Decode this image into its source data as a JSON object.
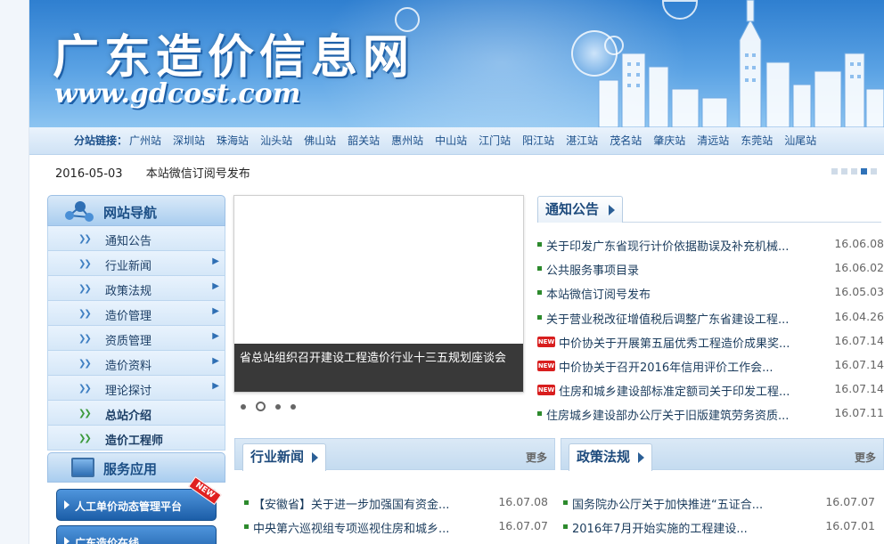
{
  "banner": {
    "title": "广东造价信息网",
    "url": "www.gdcost.com"
  },
  "branch": {
    "label": "分站链接：",
    "items": [
      "广州站",
      "深圳站",
      "珠海站",
      "汕头站",
      "佛山站",
      "韶关站",
      "惠州站",
      "中山站",
      "江门站",
      "阳江站",
      "湛江站",
      "茂名站",
      "肇庆站",
      "清远站",
      "东莞站",
      "汕尾站"
    ]
  },
  "ticker": {
    "date": "2016-05-03",
    "text": "本站微信订阅号发布"
  },
  "nav": {
    "title": "网站导航",
    "items": [
      {
        "label": "通知公告",
        "bold": false,
        "chevron": false
      },
      {
        "label": "行业新闻",
        "bold": false,
        "chevron": true
      },
      {
        "label": "政策法规",
        "bold": false,
        "chevron": true
      },
      {
        "label": "造价管理",
        "bold": false,
        "chevron": true
      },
      {
        "label": "资质管理",
        "bold": false,
        "chevron": true
      },
      {
        "label": "造价资料",
        "bold": false,
        "chevron": true
      },
      {
        "label": "理论探讨",
        "bold": false,
        "chevron": true
      },
      {
        "label": "总站介绍",
        "bold": true,
        "chevron": false
      },
      {
        "label": "造价工程师",
        "bold": true,
        "chevron": false
      }
    ],
    "service_title": "服务应用",
    "service_buttons": [
      {
        "label": "人工单价动态管理平台",
        "badge": "NEW"
      },
      {
        "label": "广东造价在线",
        "badge": ""
      }
    ]
  },
  "slide": {
    "caption": "省总站组织召开建设工程造价行业十三五规划座谈会"
  },
  "notice": {
    "title": "通知公告",
    "items": [
      {
        "title": "关于印发广东省现行计价依据勘误及补充机械...",
        "date": "16.06.08",
        "new": false
      },
      {
        "title": "公共服务事项目录",
        "date": "16.06.02",
        "new": false
      },
      {
        "title": "本站微信订阅号发布",
        "date": "16.05.03",
        "new": false
      },
      {
        "title": "关于营业税改征增值税后调整广东省建设工程...",
        "date": "16.04.26",
        "new": false
      },
      {
        "title": "中价协关于开展第五届优秀工程造价成果奖...",
        "date": "16.07.14",
        "new": true
      },
      {
        "title": "中价协关于召开2016年信用评价工作会...",
        "date": "16.07.14",
        "new": true
      },
      {
        "title": "住房和城乡建设部标准定额司关于印发工程...",
        "date": "16.07.14",
        "new": true
      },
      {
        "title": "住房城乡建设部办公厅关于旧版建筑劳务资质...",
        "date": "16.07.11",
        "new": false
      }
    ]
  },
  "industry": {
    "title": "行业新闻",
    "more": "更多",
    "items": [
      {
        "title": "【安徽省】关于进一步加强国有资金...",
        "date": "16.07.08"
      },
      {
        "title": "中央第六巡视组专项巡视住房和城乡...",
        "date": "16.07.07"
      }
    ]
  },
  "policy": {
    "title": "政策法规",
    "more": "更多",
    "items": [
      {
        "title": "国务院办公厅关于加快推进“五证合...",
        "date": "16.07.07"
      },
      {
        "title": "2016年7月开始实施的工程建设...",
        "date": "16.07.01"
      }
    ]
  },
  "colors": {
    "accent": "#1c4f86",
    "banner": "#2f7fd0",
    "bullet": "#2d8a2d",
    "new_badge": "#d81e1e"
  }
}
